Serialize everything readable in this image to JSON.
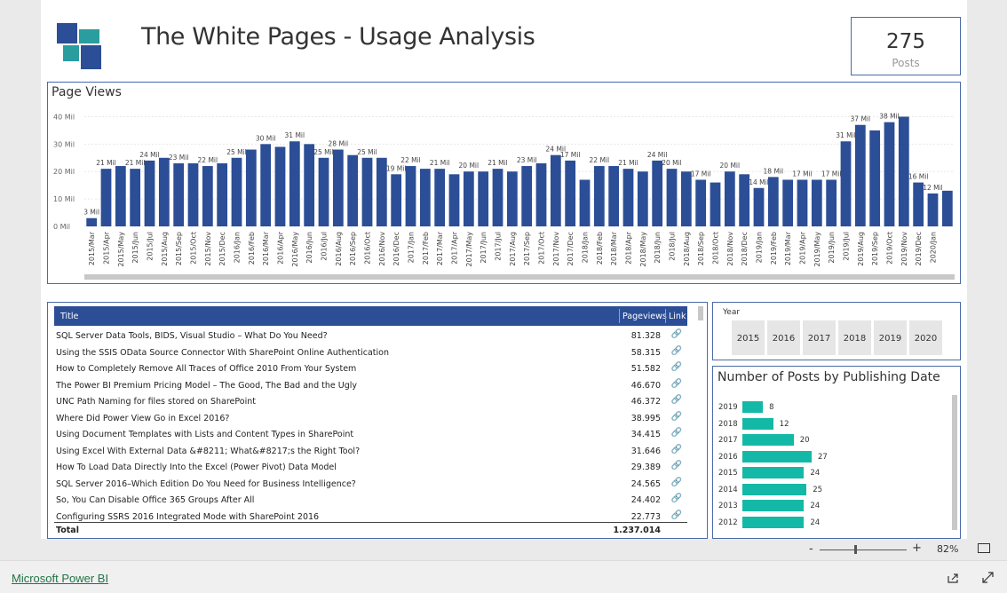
{
  "header": {
    "title": "The White Pages - Usage Analysis"
  },
  "card": {
    "value": "275",
    "label": "Posts"
  },
  "page_views": {
    "title": "Page Views"
  },
  "chart_data": [
    {
      "type": "bar",
      "title": "Page Views",
      "ylim": [
        0,
        45
      ],
      "y_ticks": [
        "0 Mil",
        "10 Mil",
        "20 Mil",
        "30 Mil",
        "40 Mil"
      ],
      "categories": [
        "2015/Mar",
        "2015/Apr",
        "2015/May",
        "2015/Jun",
        "2015/Jul",
        "2015/Aug",
        "2015/Sep",
        "2015/Oct",
        "2015/Nov",
        "2015/Dec",
        "2016/Jan",
        "2016/Feb",
        "2016/Mar",
        "2016/Apr",
        "2016/May",
        "2016/Jun",
        "2016/Jul",
        "2016/Aug",
        "2016/Sep",
        "2016/Oct",
        "2016/Nov",
        "2016/Dec",
        "2017/Jan",
        "2017/Feb",
        "2017/Mar",
        "2017/Apr",
        "2017/May",
        "2017/Jun",
        "2017/Jul",
        "2017/Aug",
        "2017/Sep",
        "2017/Oct",
        "2017/Nov",
        "2017/Dec",
        "2018/Jan",
        "2018/Feb",
        "2018/Mar",
        "2018/Apr",
        "2018/May",
        "2018/Jun",
        "2018/Jul",
        "2018/Aug",
        "2018/Sep",
        "2018/Oct",
        "2018/Nov",
        "2018/Dec",
        "2019/Jan",
        "2019/Feb",
        "2019/Mar",
        "2019/Apr",
        "2019/May",
        "2019/Jun",
        "2019/Jul",
        "2019/Aug",
        "2019/Sep",
        "2019/Oct",
        "2019/Nov",
        "2019/Dec",
        "2020/Jan"
      ],
      "values": [
        3,
        21,
        22,
        21,
        24,
        25,
        23,
        23,
        22,
        23,
        25,
        28,
        30,
        29,
        31,
        30,
        25,
        28,
        26,
        25,
        25,
        19,
        22,
        21,
        21,
        19,
        20,
        20,
        21,
        20,
        22,
        23,
        26,
        24,
        17,
        22,
        22,
        21,
        20,
        24,
        21,
        20,
        17,
        16,
        20,
        19,
        14,
        18,
        17,
        17,
        17,
        17,
        31,
        37,
        35,
        38,
        40,
        16,
        12,
        13
      ],
      "data_labels": [
        {
          "i": 0,
          "text": "3 Mil"
        },
        {
          "i": 1,
          "text": "21 Mil"
        },
        {
          "i": 3,
          "text": "21 Mil"
        },
        {
          "i": 4,
          "text": "24 Mil"
        },
        {
          "i": 6,
          "text": "23 Mil"
        },
        {
          "i": 8,
          "text": "22 Mil"
        },
        {
          "i": 10,
          "text": "25 Mil"
        },
        {
          "i": 12,
          "text": "30 Mil"
        },
        {
          "i": 14,
          "text": "31 Mil"
        },
        {
          "i": 16,
          "text": "25 Mil"
        },
        {
          "i": 17,
          "text": "28 Mil"
        },
        {
          "i": 19,
          "text": "25 Mil"
        },
        {
          "i": 21,
          "text": "19 Mil"
        },
        {
          "i": 22,
          "text": "22 Mil"
        },
        {
          "i": 24,
          "text": "21 Mil"
        },
        {
          "i": 26,
          "text": "20 Mil"
        },
        {
          "i": 28,
          "text": "21 Mil"
        },
        {
          "i": 30,
          "text": "23 Mil"
        },
        {
          "i": 32,
          "text": "24 Mil"
        },
        {
          "i": 33,
          "text": "17 Mil"
        },
        {
          "i": 35,
          "text": "22 Mil"
        },
        {
          "i": 37,
          "text": "21 Mil"
        },
        {
          "i": 39,
          "text": "24 Mil"
        },
        {
          "i": 40,
          "text": "20 Mil"
        },
        {
          "i": 42,
          "text": "17 Mil"
        },
        {
          "i": 44,
          "text": "20 Mil"
        },
        {
          "i": 46,
          "text": "14 Mil"
        },
        {
          "i": 47,
          "text": "18 Mil"
        },
        {
          "i": 49,
          "text": "17 Mil"
        },
        {
          "i": 51,
          "text": "17 Mil"
        },
        {
          "i": 52,
          "text": "31 Mil"
        },
        {
          "i": 53,
          "text": "37 Mil"
        },
        {
          "i": 55,
          "text": "38 Mil"
        },
        {
          "i": 57,
          "text": "16 Mil"
        },
        {
          "i": 58,
          "text": "12 Mil"
        }
      ],
      "color": "#2b4e96",
      "grid": true
    },
    {
      "type": "bar",
      "title": "Number of Posts by Publishing Date",
      "orientation": "horizontal",
      "categories": [
        "2019",
        "2018",
        "2017",
        "2016",
        "2015",
        "2014",
        "2013",
        "2012"
      ],
      "values": [
        8,
        12,
        20,
        27,
        24,
        25,
        24,
        24
      ],
      "color": "#14b8a6"
    }
  ],
  "table": {
    "headers": {
      "title": "Title",
      "pageviews": "Pageviews",
      "link": "Link"
    },
    "rows": [
      {
        "title": "SQL Server Data Tools, BIDS, Visual Studio – What Do You Need?",
        "views": "81.328"
      },
      {
        "title": "Using the SSIS OData Source Connector With SharePoint Online Authentication",
        "views": "58.315"
      },
      {
        "title": "How to Completely Remove All Traces of Office 2010 From Your System",
        "views": "51.582"
      },
      {
        "title": "The Power BI Premium Pricing Model – The Good, The Bad and the Ugly",
        "views": "46.670"
      },
      {
        "title": "UNC Path Naming for files stored on SharePoint",
        "views": "46.372"
      },
      {
        "title": "Where Did Power View Go in Excel 2016?",
        "views": "38.995"
      },
      {
        "title": "Using Document Templates with Lists and Content Types in SharePoint",
        "views": "34.415"
      },
      {
        "title": "Using Excel With External Data &#8211; What&#8217;s the Right Tool?",
        "views": "31.646"
      },
      {
        "title": "How To Load Data Directly Into the Excel (Power Pivot) Data Model",
        "views": "29.389"
      },
      {
        "title": "SQL Server 2016–Which Edition Do You Need for Business Intelligence?",
        "views": "24.565"
      },
      {
        "title": "So, You Can Disable Office 365 Groups After All",
        "views": "24.402"
      },
      {
        "title": "Configuring SSRS 2016 Integrated Mode with SharePoint 2016",
        "views": "22.773"
      }
    ],
    "total_label": "Total",
    "total_value": "1.237.014"
  },
  "year_slicer": {
    "label": "Year",
    "options": [
      "2015",
      "2016",
      "2017",
      "2018",
      "2019",
      "2020"
    ]
  },
  "posts_chart": {
    "title": "Number of Posts by Publishing Date"
  },
  "status": {
    "zoom": "82%",
    "zoom_level": 0.5
  },
  "footer": {
    "brand": "Microsoft Power BI"
  },
  "icons": {
    "link": "link-icon",
    "share": "share-icon",
    "expand": "expand-icon",
    "fit": "fit-page-icon"
  }
}
